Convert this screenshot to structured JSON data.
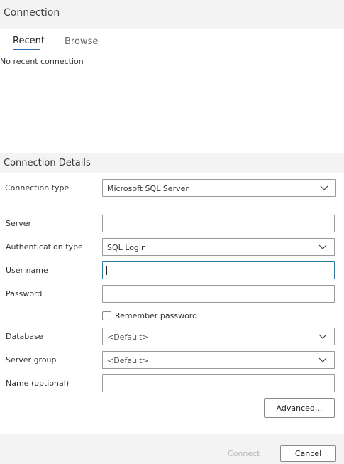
{
  "dialog": {
    "title": "Connection"
  },
  "tabs": [
    {
      "label": "Recent",
      "active": true
    },
    {
      "label": "Browse",
      "active": false
    }
  ],
  "recent": {
    "empty_text": "No recent connection"
  },
  "details": {
    "title": "Connection Details",
    "connection_type": {
      "label": "Connection type",
      "value": "Microsoft SQL Server"
    },
    "server": {
      "label": "Server",
      "value": ""
    },
    "auth_type": {
      "label": "Authentication type",
      "value": "SQL Login"
    },
    "user_name": {
      "label": "User name",
      "value": ""
    },
    "password": {
      "label": "Password",
      "value": ""
    },
    "remember_password": {
      "label": "Remember password",
      "checked": false
    },
    "database": {
      "label": "Database",
      "value": "<Default>"
    },
    "server_group": {
      "label": "Server group",
      "value": "<Default>"
    },
    "name": {
      "label": "Name (optional)",
      "value": ""
    },
    "advanced_label": "Advanced..."
  },
  "footer": {
    "connect_label": "Connect",
    "cancel_label": "Cancel"
  },
  "colors": {
    "accent": "#2f6eb5",
    "focus_border": "#2c7a9e",
    "band_bg": "#f3f3f3"
  }
}
